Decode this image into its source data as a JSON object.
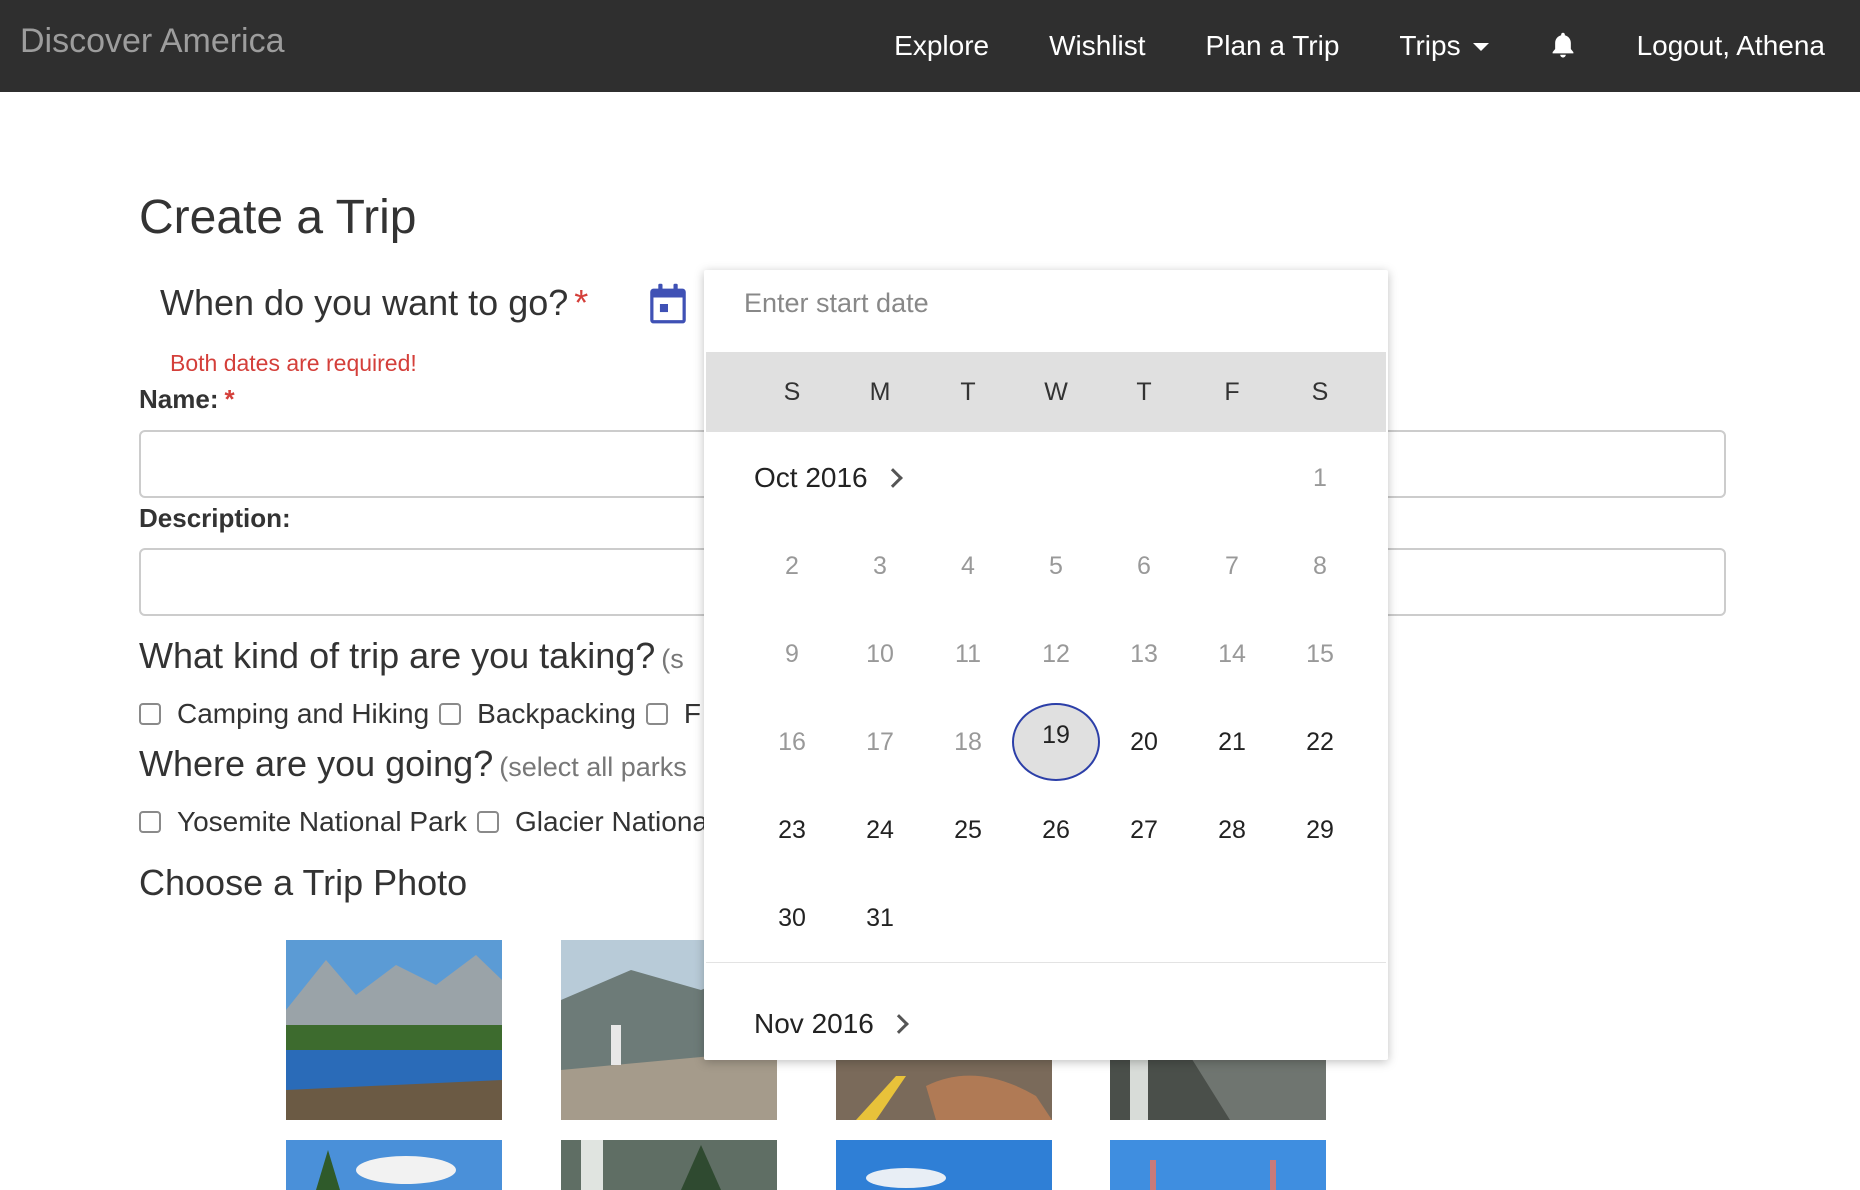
{
  "navbar": {
    "brand": "Discover America",
    "items": [
      {
        "label": "Explore"
      },
      {
        "label": "Wishlist"
      },
      {
        "label": "Plan a Trip"
      },
      {
        "label": "Trips"
      },
      {
        "label": "Logout, Athena"
      }
    ]
  },
  "page": {
    "title": "Create a Trip",
    "when_label": "When do you want to go?",
    "required_mark": "*",
    "date_error": "Both dates are required!",
    "name_label": "Name:",
    "description_label": "Description:",
    "trip_kind_heading": "What kind of trip are you taking?",
    "trip_kind_hint": "(s",
    "trip_kinds": [
      "Camping and Hiking",
      "Backpacking",
      "F"
    ],
    "where_heading": "Where are you going?",
    "where_hint": "(select all parks",
    "parks": [
      "Yosemite National Park",
      "Glacier Nationa"
    ],
    "photo_heading": "Choose a Trip Photo"
  },
  "datepicker": {
    "placeholder": "Enter start date",
    "weekdays": [
      "S",
      "M",
      "T",
      "W",
      "T",
      "F",
      "S"
    ],
    "month1": "Oct 2016",
    "month2": "Nov 2016",
    "today": "19",
    "weeks": [
      [
        "",
        "",
        "",
        "",
        "",
        "",
        "1"
      ],
      [
        "2",
        "3",
        "4",
        "5",
        "6",
        "7",
        "8"
      ],
      [
        "9",
        "10",
        "11",
        "12",
        "13",
        "14",
        "15"
      ],
      [
        "16",
        "17",
        "18",
        "19",
        "20",
        "21",
        "22"
      ],
      [
        "23",
        "24",
        "25",
        "26",
        "27",
        "28",
        "29"
      ],
      [
        "30",
        "31",
        "",
        "",
        "",
        "",
        ""
      ]
    ]
  },
  "icons": {
    "bell": "bell-icon",
    "calendar": "calendar-icon",
    "caret": "caret-down-icon",
    "chevron": "chevron-right-icon"
  },
  "colors": {
    "navbar": "#2f2f2f",
    "required": "#d43f3a",
    "calendar_icon": "#3f51b5",
    "today_ring": "#2c3fa8"
  }
}
